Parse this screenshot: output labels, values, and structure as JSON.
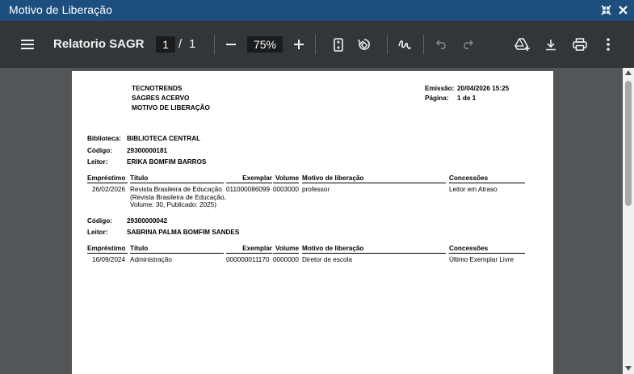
{
  "window": {
    "title": "Motivo de Liberação"
  },
  "toolbar": {
    "doc_title": "Relatorio SAGR...",
    "current_page": "1",
    "page_separator": "/",
    "total_pages": "1",
    "zoom": "75%"
  },
  "report": {
    "header": {
      "company": "TECNOTRENDS",
      "system": "SAGRES ACERVO",
      "report_name": "MOTIVO DE LIBERAÇÃO",
      "emission_label": "Emissão:",
      "emission_value": "20/04/2026 15:25",
      "page_label": "Página:",
      "page_value": "1 de 1"
    },
    "library_label": "Biblioteca:",
    "library_value": "BIBLIOTECA CENTRAL",
    "columns": {
      "loan": "Empréstimo",
      "title": "Título",
      "copy": "Exemplar",
      "volume": "Volume",
      "reason": "Motivo de liberação",
      "concessions": "Concessões"
    },
    "code_label": "Código:",
    "reader_label": "Leitor:",
    "readers": [
      {
        "code": "29300000181",
        "name": "ERIKA BOMFIM BARROS",
        "rows": [
          {
            "loan": "26/02/2026",
            "title_lines": [
              "Revista Brasileira de Educação",
              "(Revista Brasileira de Educação,",
              "Volume: 30, Publicado: 2025)"
            ],
            "copy": "011000086099",
            "volume": "0003000",
            "reason": "professor",
            "concession": "Leitor em Atraso"
          }
        ]
      },
      {
        "code": "29300000042",
        "name": "SABRINA PALMA BOMFIM SANDES",
        "rows": [
          {
            "loan": "16/09/2024",
            "title_lines": [
              "Administração"
            ],
            "copy": "000000011170",
            "volume": "0000000",
            "reason": "Diretor de escola",
            "concession": "Último Exemplar Livre"
          }
        ]
      }
    ]
  }
}
